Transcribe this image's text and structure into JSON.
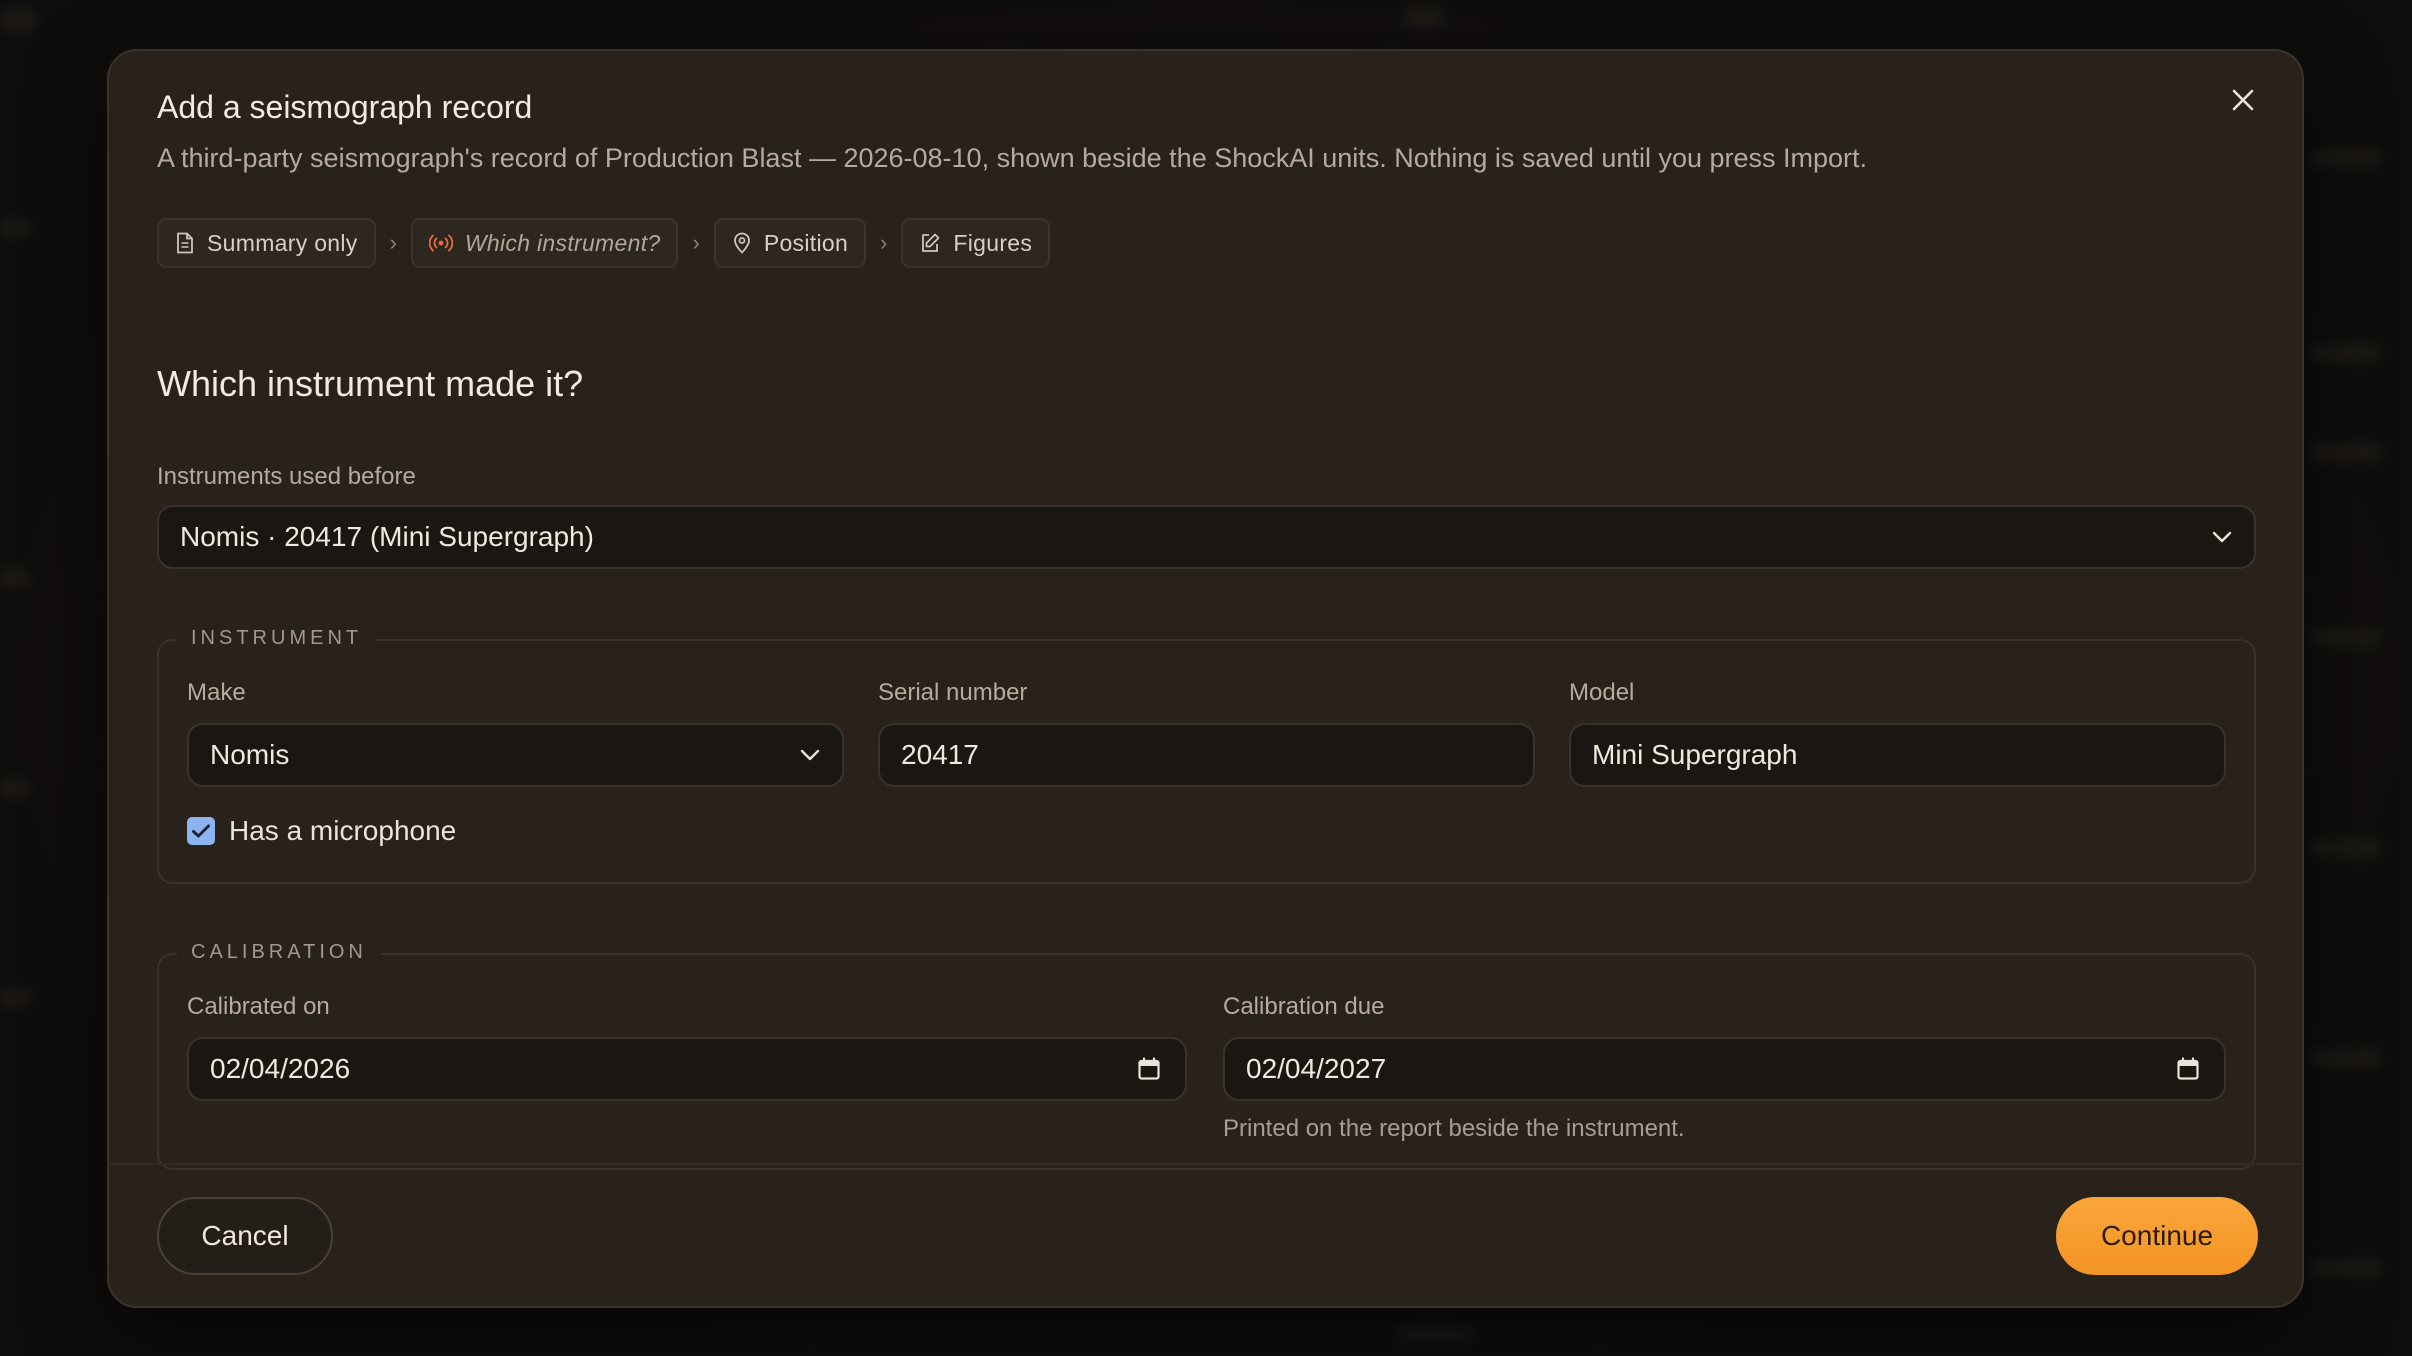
{
  "dialog": {
    "title": "Add a seismograph record",
    "description": "A third-party seismograph's record of Production Blast — 2026-08-10, shown beside the ShockAI units. Nothing is saved until you press Import.",
    "close_icon": "close-icon"
  },
  "steps": [
    {
      "label": "Summary only",
      "icon": "document-icon",
      "state": "done"
    },
    {
      "label": "Which instrument?",
      "icon": "broadcast-icon",
      "state": "current"
    },
    {
      "label": "Position",
      "icon": "map-pin-icon",
      "state": "upcoming"
    },
    {
      "label": "Figures",
      "icon": "edit-icon",
      "state": "upcoming"
    }
  ],
  "section": {
    "heading": "Which instrument made it?"
  },
  "previous": {
    "label": "Instruments used before",
    "value": "Nomis · 20417 (Mini Supergraph)"
  },
  "instrument": {
    "legend": "INSTRUMENT",
    "make_label": "Make",
    "make_value": "Nomis",
    "serial_label": "Serial number",
    "serial_value": "20417",
    "model_label": "Model",
    "model_value": "Mini Supergraph",
    "microphone_label": "Has a microphone",
    "microphone_checked": true
  },
  "calibration": {
    "legend": "CALIBRATION",
    "calibrated_on_label": "Calibrated on",
    "calibrated_on_value": "02/04/2026",
    "due_label": "Calibration due",
    "due_value": "02/04/2027",
    "due_hint": "Printed on the report beside the instrument."
  },
  "footer": {
    "cancel_label": "Cancel",
    "continue_label": "Continue"
  },
  "colors": {
    "accent": "#f39c2f",
    "checkbox": "#8cb4f0",
    "current_step_icon": "#e2703a"
  }
}
